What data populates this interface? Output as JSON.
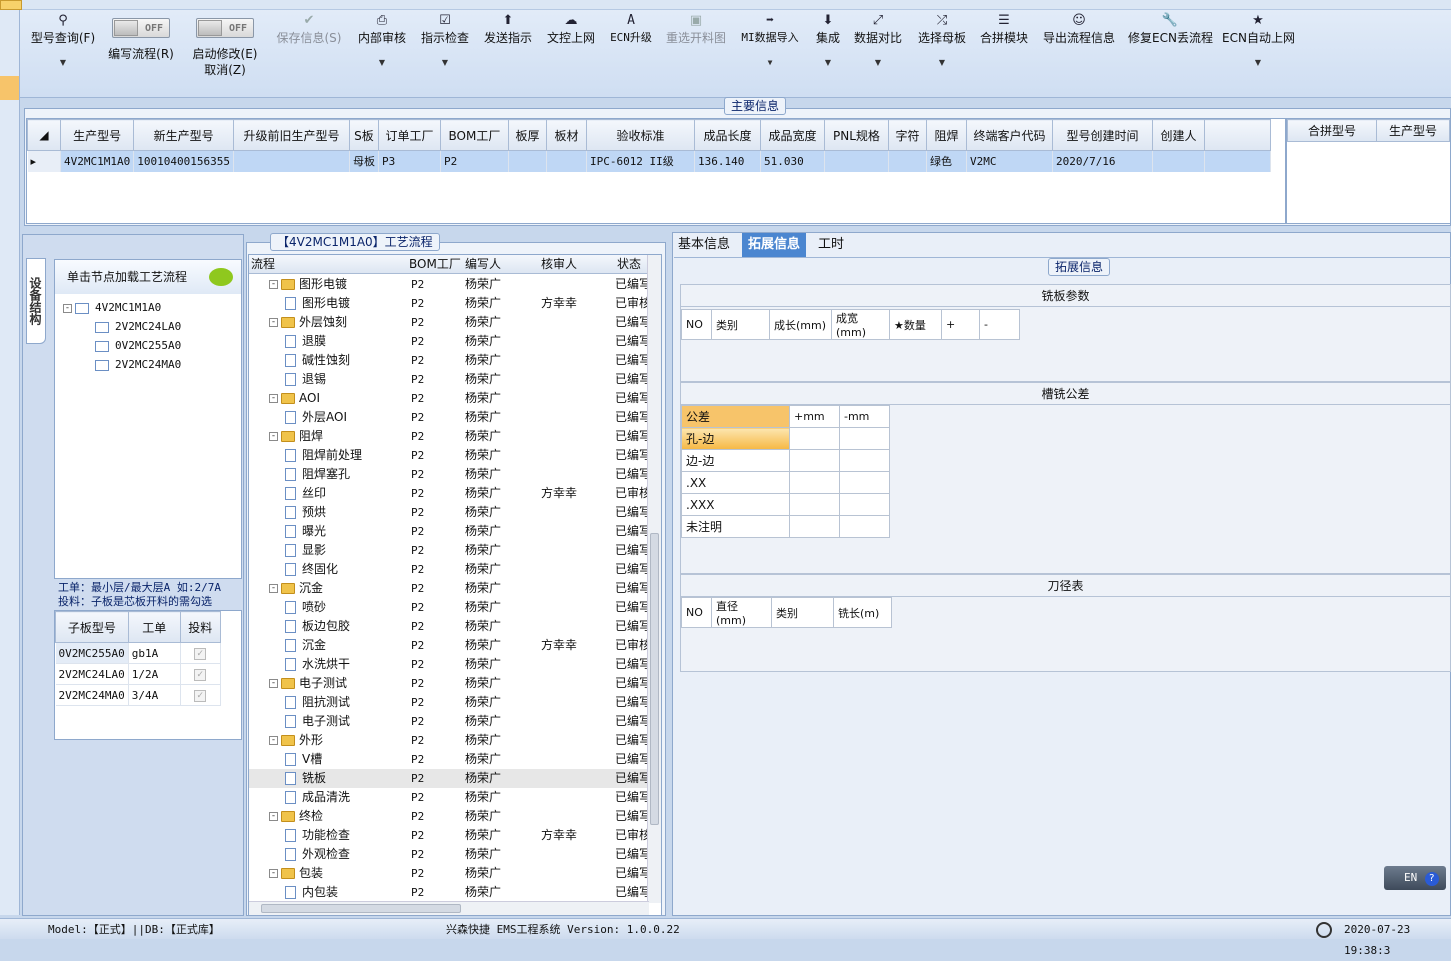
{
  "ribbon": {
    "model_query": "型号查询(F)",
    "edit_flow": "编写流程(R)",
    "start_modify": "启动修改(E)",
    "cancel": "取消(Z)",
    "toggle_off": "OFF",
    "save_info": "保存信息(S)",
    "internal_review": "内部审核",
    "instruction_check": "指示检查",
    "send_instruction": "发送指示",
    "doc_upload": "文控上网",
    "ecn_upgrade": "ECN升级",
    "reselect_cut": "重选开料图",
    "mi_import": "MI数据导入",
    "integrate": "集成",
    "data_compare": "数据对比",
    "select_mother": "选择母板",
    "merge_module": "合拼模块",
    "export_flow": "导出流程信息",
    "fix_ecn": "修复ECN丢流程",
    "ecn_auto": "ECN自动上网"
  },
  "main_info": {
    "title": "主要信息",
    "columns": [
      "生产型号",
      "新生产型号",
      "升级前旧生产型号",
      "S板",
      "订单工厂",
      "BOM工厂",
      "板厚",
      "板材",
      "验收标准",
      "成品长度",
      "成品宽度",
      "PNL规格",
      "字符",
      "阻焊",
      "终端客户代码",
      "型号创建时间",
      "创建人"
    ],
    "row": [
      "4V2MC1M1A0",
      "10010400156355",
      "",
      "母板",
      "P3",
      "P2",
      "",
      "",
      "IPC-6012 II级",
      "136.140",
      "51.030",
      "",
      "",
      "绿色",
      "V2MC",
      "2020/7/16",
      ""
    ],
    "right_columns": [
      "合拼型号",
      "生产型号"
    ]
  },
  "left": {
    "vertical_tab": "设备结构",
    "hint": "单击节点加载工艺流程",
    "tree_root": "4V2MC1M1A0",
    "tree_children": [
      "2V2MC24LA0",
      "0V2MC255A0",
      "2V2MC24MA0"
    ],
    "note1": "工单：最小层/最大层A 如:2/7A",
    "note2": "投料：子板是芯板开料的需勾选",
    "sub_columns": [
      "子板型号",
      "工单",
      "投料"
    ],
    "sub_rows": [
      {
        "model": "0V2MC255A0",
        "order": "gb1A"
      },
      {
        "model": "2V2MC24LA0",
        "order": "1/2A"
      },
      {
        "model": "2V2MC24MA0",
        "order": "3/4A"
      }
    ]
  },
  "flow": {
    "title": "【4V2MC1M1A0】工艺流程",
    "columns": [
      "流程",
      "BOM工厂",
      "编写人",
      "核审人",
      "状态"
    ],
    "rows": [
      {
        "name": "图形电镀",
        "type": "folder",
        "bom": "P2",
        "writer": "杨荣广",
        "reviewer": "",
        "status": "已编写"
      },
      {
        "name": "图形电镀",
        "type": "doc",
        "bom": "P2",
        "writer": "杨荣广",
        "reviewer": "方幸幸",
        "status": "已审核"
      },
      {
        "name": "外层蚀刻",
        "type": "folder",
        "bom": "P2",
        "writer": "杨荣广",
        "reviewer": "",
        "status": "已编写"
      },
      {
        "name": "退膜",
        "type": "doc",
        "bom": "P2",
        "writer": "杨荣广",
        "reviewer": "",
        "status": "已编写"
      },
      {
        "name": "碱性蚀刻",
        "type": "doc",
        "bom": "P2",
        "writer": "杨荣广",
        "reviewer": "",
        "status": "已编写"
      },
      {
        "name": "退锡",
        "type": "doc",
        "bom": "P2",
        "writer": "杨荣广",
        "reviewer": "",
        "status": "已编写"
      },
      {
        "name": "AOI",
        "type": "folder",
        "bom": "P2",
        "writer": "杨荣广",
        "reviewer": "",
        "status": "已编写"
      },
      {
        "name": "外层AOI",
        "type": "doc",
        "bom": "P2",
        "writer": "杨荣广",
        "reviewer": "",
        "status": "已编写"
      },
      {
        "name": "阻焊",
        "type": "folder",
        "bom": "P2",
        "writer": "杨荣广",
        "reviewer": "",
        "status": "已编写"
      },
      {
        "name": "阻焊前处理",
        "type": "doc",
        "bom": "P2",
        "writer": "杨荣广",
        "reviewer": "",
        "status": "已编写"
      },
      {
        "name": "阻焊塞孔",
        "type": "doc",
        "bom": "P2",
        "writer": "杨荣广",
        "reviewer": "",
        "status": "已编写"
      },
      {
        "name": "丝印",
        "type": "doc",
        "bom": "P2",
        "writer": "杨荣广",
        "reviewer": "方幸幸",
        "status": "已审核"
      },
      {
        "name": "预烘",
        "type": "doc",
        "bom": "P2",
        "writer": "杨荣广",
        "reviewer": "",
        "status": "已编写"
      },
      {
        "name": "曝光",
        "type": "doc",
        "bom": "P2",
        "writer": "杨荣广",
        "reviewer": "",
        "status": "已编写"
      },
      {
        "name": "显影",
        "type": "doc",
        "bom": "P2",
        "writer": "杨荣广",
        "reviewer": "",
        "status": "已编写"
      },
      {
        "name": "终固化",
        "type": "doc",
        "bom": "P2",
        "writer": "杨荣广",
        "reviewer": "",
        "status": "已编写"
      },
      {
        "name": "沉金",
        "type": "folder",
        "bom": "P2",
        "writer": "杨荣广",
        "reviewer": "",
        "status": "已编写"
      },
      {
        "name": "喷砂",
        "type": "doc",
        "bom": "P2",
        "writer": "杨荣广",
        "reviewer": "",
        "status": "已编写"
      },
      {
        "name": "板边包胶",
        "type": "doc",
        "bom": "P2",
        "writer": "杨荣广",
        "reviewer": "",
        "status": "已编写"
      },
      {
        "name": "沉金",
        "type": "doc",
        "bom": "P2",
        "writer": "杨荣广",
        "reviewer": "方幸幸",
        "status": "已审核"
      },
      {
        "name": "水洗烘干",
        "type": "doc",
        "bom": "P2",
        "writer": "杨荣广",
        "reviewer": "",
        "status": "已编写"
      },
      {
        "name": "电子测试",
        "type": "folder",
        "bom": "P2",
        "writer": "杨荣广",
        "reviewer": "",
        "status": "已编写"
      },
      {
        "name": "阻抗测试",
        "type": "doc",
        "bom": "P2",
        "writer": "杨荣广",
        "reviewer": "",
        "status": "已编写"
      },
      {
        "name": "电子测试",
        "type": "doc",
        "bom": "P2",
        "writer": "杨荣广",
        "reviewer": "",
        "status": "已编写"
      },
      {
        "name": "外形",
        "type": "folder",
        "bom": "P2",
        "writer": "杨荣广",
        "reviewer": "",
        "status": "已编写"
      },
      {
        "name": "V槽",
        "type": "doc",
        "bom": "P2",
        "writer": "杨荣广",
        "reviewer": "",
        "status": "已编写"
      },
      {
        "name": "铣板",
        "type": "doc",
        "bom": "P2",
        "writer": "杨荣广",
        "reviewer": "",
        "status": "已编写"
      },
      {
        "name": "成品清洗",
        "type": "doc",
        "bom": "P2",
        "writer": "杨荣广",
        "reviewer": "",
        "status": "已编写"
      },
      {
        "name": "终检",
        "type": "folder",
        "bom": "P2",
        "writer": "杨荣广",
        "reviewer": "",
        "status": "已编写"
      },
      {
        "name": "功能检查",
        "type": "doc",
        "bom": "P2",
        "writer": "杨荣广",
        "reviewer": "方幸幸",
        "status": "已审核"
      },
      {
        "name": "外观检查",
        "type": "doc",
        "bom": "P2",
        "writer": "杨荣广",
        "reviewer": "",
        "status": "已编写"
      },
      {
        "name": "包装",
        "type": "folder",
        "bom": "P2",
        "writer": "杨荣广",
        "reviewer": "",
        "status": "已编写"
      },
      {
        "name": "内包装",
        "type": "doc",
        "bom": "P2",
        "writer": "杨荣广",
        "reviewer": "",
        "status": "已编写"
      }
    ]
  },
  "right": {
    "tabs": [
      "基本信息",
      "拓展信息",
      "工时"
    ],
    "group_title": "拓展信息",
    "mill_params_title": "铣板参数",
    "mill_columns": [
      "NO",
      "类别",
      "成长(mm)",
      "成宽(mm)",
      "★数量",
      "+",
      "-"
    ],
    "tolerance_title": "槽铣公差",
    "tol_header": [
      "公差",
      "+mm",
      "-mm"
    ],
    "tol_rows": [
      "孔-边",
      "边-边",
      ".XX",
      ".XXX",
      "未注明"
    ],
    "tool_title": "刀径表",
    "tool_columns": [
      "NO",
      "直径(mm)",
      "类别",
      "铣长(m)"
    ],
    "lang": "EN"
  },
  "status": {
    "model": "Model:【正式】||DB:【正式库】",
    "app": "兴森快捷 EMS工程系统 Version: 1.0.0.22",
    "time": "2020-07-23 19:38:3"
  }
}
